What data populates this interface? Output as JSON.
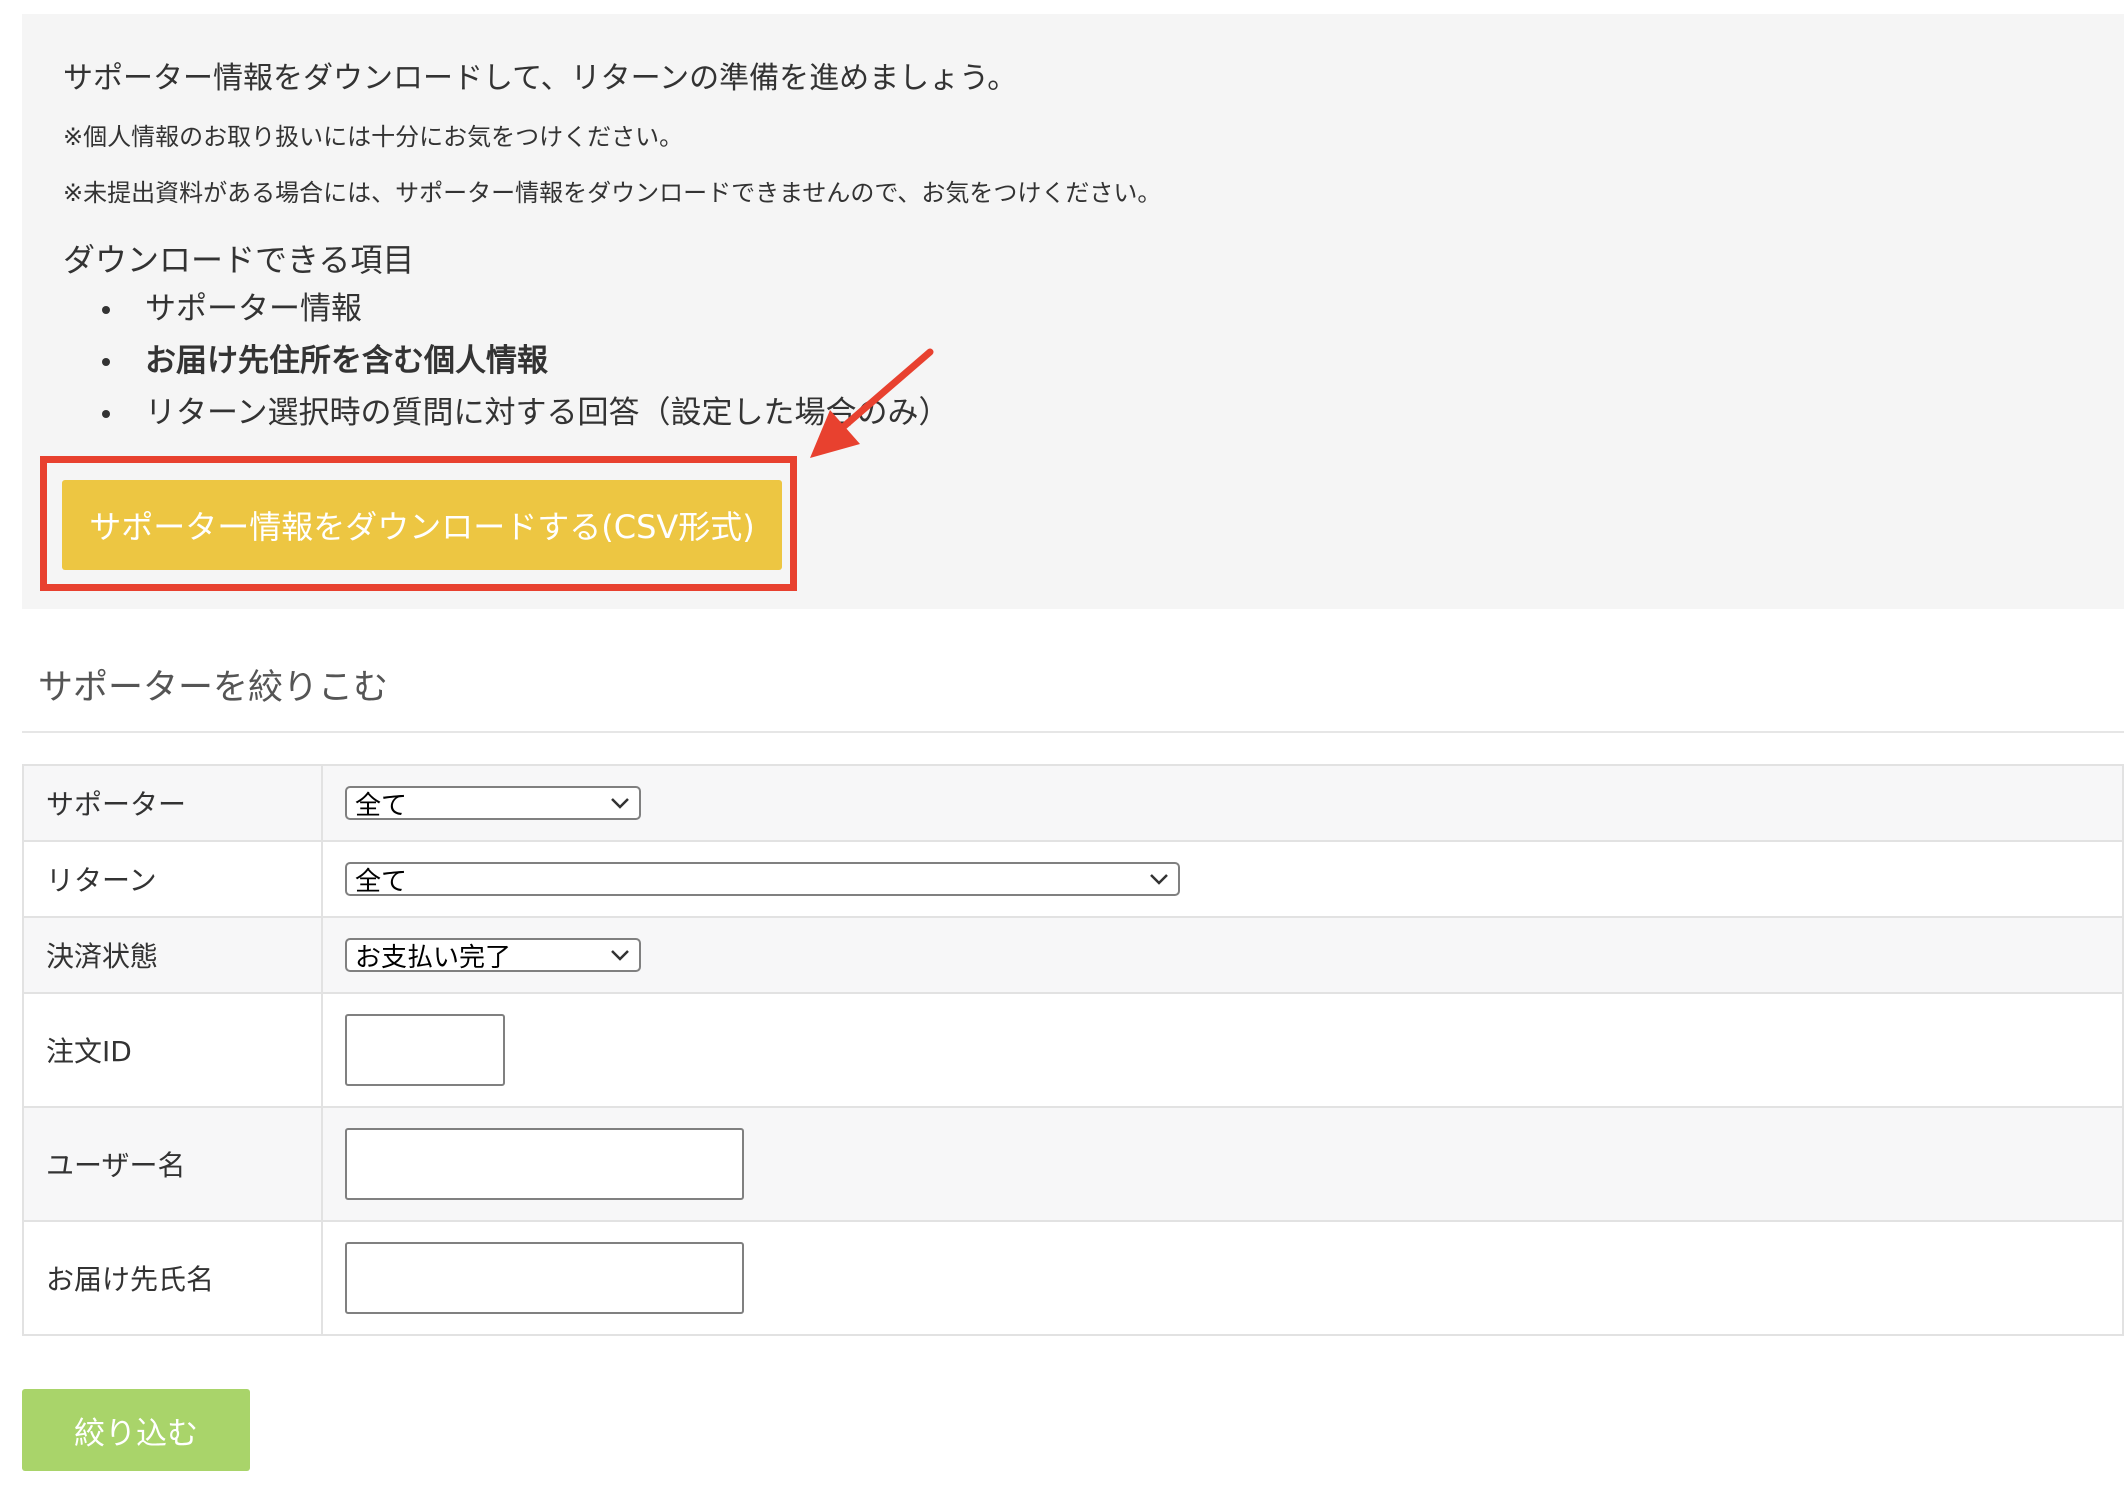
{
  "download_section": {
    "lead_text": "サポーター情報をダウンロードして、リターンの準備を進めましょう。",
    "note_privacy": "※個人情報のお取り扱いには十分にお気をつけください。",
    "note_missing_docs": "※未提出資料がある場合には、サポーター情報をダウンロードできませんので、お気をつけください。",
    "items_title": "ダウンロードできる項目",
    "items": [
      {
        "label": "サポーター情報"
      },
      {
        "label": "お届け先住所を含む個人情報"
      },
      {
        "label": "リターン選択時の質問に対する回答（設定した場合のみ）"
      }
    ],
    "download_button_label": "サポーター情報をダウンロードする(CSV形式)"
  },
  "filter": {
    "title": "サポーターを絞りこむ",
    "rows": [
      {
        "label": "サポーター",
        "selected": "全て"
      },
      {
        "label": "リターン",
        "selected": "全て"
      },
      {
        "label": "決済状態",
        "selected": "お支払い完了"
      },
      {
        "label": "注文ID",
        "value": ""
      },
      {
        "label": "ユーザー名",
        "value": ""
      },
      {
        "label": "お届け先氏名",
        "value": ""
      }
    ],
    "submit_label": "絞り込む"
  },
  "colors": {
    "download_button": "#edc642",
    "highlight_annotation": "#e8412f",
    "filter_button": "#a9d46a",
    "panel_background": "#f5f5f5"
  }
}
